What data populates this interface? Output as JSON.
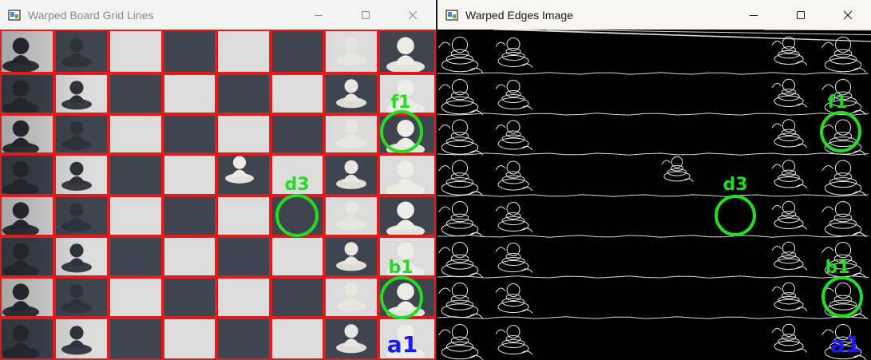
{
  "windows": {
    "left": {
      "title": "Warped Board Grid Lines",
      "markers": [
        {
          "label": "f1",
          "color": "#22dd22"
        },
        {
          "label": "d3",
          "color": "#22dd22"
        },
        {
          "label": "b1",
          "color": "#22dd22"
        },
        {
          "label": "a1",
          "color": "#1a1aee"
        }
      ],
      "grid_color": "#e11b1b"
    },
    "right": {
      "title": "Warped Edges Image",
      "markers": [
        {
          "label": "f1",
          "color": "#22dd22"
        },
        {
          "label": "d3",
          "color": "#22dd22"
        },
        {
          "label": "b1",
          "color": "#22dd22"
        },
        {
          "label": "a1",
          "color": "#1a1aee"
        }
      ]
    }
  },
  "controls": {
    "minimize_icon": "minimize-icon",
    "maximize_icon": "maximize-icon",
    "close_icon": "close-icon"
  }
}
